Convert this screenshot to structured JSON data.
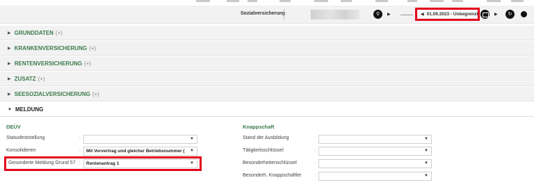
{
  "toolbar": {
    "label": "Sozialversicherung",
    "period": "01.09.2023 - Unbegrenzt"
  },
  "sections": [
    {
      "label": "GRUNDDATEN",
      "plus": "(+)"
    },
    {
      "label": "KRANKENVERSICHERUNG",
      "plus": "(+)"
    },
    {
      "label": "RENTENVERSICHERUNG",
      "plus": "(+)"
    },
    {
      "label": "ZUSATZ",
      "plus": "(+)"
    },
    {
      "label": "SEESOZIALVERSICHERUNG",
      "plus": "(+)"
    },
    {
      "label": "MELDUNG",
      "plus": ""
    }
  ],
  "deuev": {
    "title": "DEÜV",
    "statusfeststellung": {
      "label": "Statusfeststellung",
      "value": ""
    },
    "konsolidieren": {
      "label": "Konsolidieren",
      "value": "Mit Vorvertrag und gleicher Betriebsnummer ("
    },
    "gesonderte": {
      "label": "Gesonderte Meldung Grund 57",
      "value": "Rentenantrag 1"
    }
  },
  "knappschaft": {
    "title": "Knappschaft",
    "stand": {
      "label": "Stand der Ausbildung",
      "value": ""
    },
    "taetigkeit": {
      "label": "Tätigkeitsschlüssel",
      "value": ""
    },
    "besonderheiten": {
      "label": "Besonderheitenschlüssel",
      "value": ""
    },
    "knappschaftler": {
      "label": "Besonderh. Knappschaftler",
      "value": ""
    }
  },
  "icons": {
    "search": "search-icon",
    "calendar": "calendar-icon",
    "refresh": "refresh-icon",
    "expand": "triangle-right-icon",
    "collapse": "triangle-down-icon",
    "dropdown": "chevron-down-icon"
  },
  "colors": {
    "highlight": "#e3001b",
    "section_title": "#3a7a4a"
  }
}
